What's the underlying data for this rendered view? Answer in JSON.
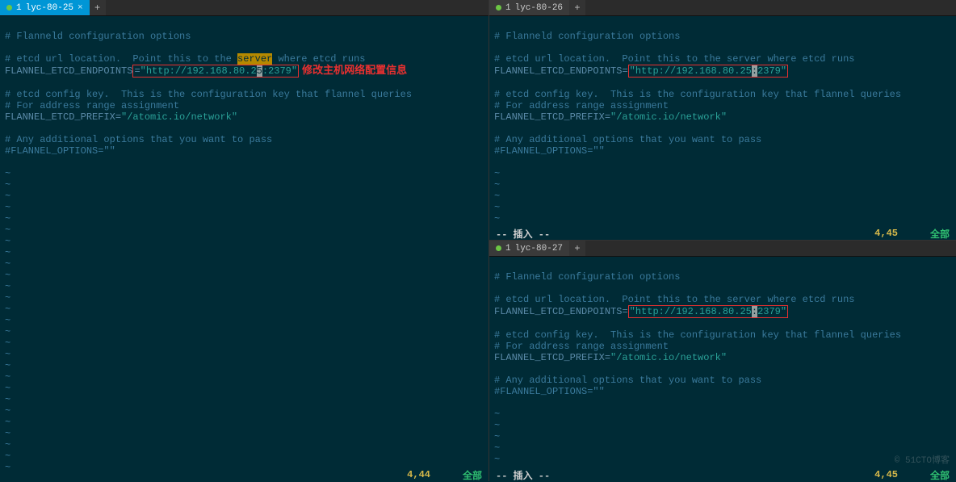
{
  "left": {
    "tab": {
      "num": "1",
      "title": "lyc-80-25",
      "close": "×"
    },
    "add": "+",
    "lines": {
      "c1": "# Flanneld configuration options",
      "c2a": "# etcd url location.  Point this to the ",
      "c2_hl": "server",
      "c2b": " where etcd runs",
      "key1": "FLANNEL_ETCD_ENDPOINTS",
      "eq": "=",
      "val1a": "\"http://192.168.80.2",
      "cursor": "5",
      "val1b": ":2379\"",
      "annot": "修改主机网络配置信息",
      "c3": "# etcd config key.  This is the configuration key that flannel queries",
      "c4": "# For address range assignment",
      "key2": "FLANNEL_ETCD_PREFIX",
      "val2": "\"/atomic.io/network\"",
      "c5": "# Any additional options that you want to pass",
      "c6": "#FLANNEL_OPTIONS=\"\"",
      "tilde": "~"
    },
    "status": {
      "pos": "4,44",
      "all": "全部"
    }
  },
  "tr": {
    "tab": {
      "num": "1",
      "title": "lyc-80-26"
    },
    "add": "+",
    "lines": {
      "c1": "# Flanneld configuration options",
      "c2": "# etcd url location.  Point this to the server where etcd runs",
      "key1": "FLANNEL_ETCD_ENDPOINTS",
      "eq": "=",
      "val1a": "\"http://192.168.80.25",
      "cursor": ":",
      "val1b": "2379\"",
      "c3": "# etcd config key.  This is the configuration key that flannel queries",
      "c4": "# For address range assignment",
      "key2": "FLANNEL_ETCD_PREFIX",
      "val2": "\"/atomic.io/network\"",
      "c5": "# Any additional options that you want to pass",
      "c6": "#FLANNEL_OPTIONS=\"\"",
      "tilde": "~"
    },
    "status": {
      "mode": "-- 插入 --",
      "pos": "4,45",
      "all": "全部"
    }
  },
  "br": {
    "tab": {
      "num": "1",
      "title": "lyc-80-27"
    },
    "add": "+",
    "lines": {
      "c1": "# Flanneld configuration options",
      "c2": "# etcd url location.  Point this to the server where etcd runs",
      "key1": "FLANNEL_ETCD_ENDPOINTS",
      "eq": "=",
      "val1a": "\"http://192.168.80.25",
      "cursor": ":",
      "val1b": "2379\"",
      "c3": "# etcd config key.  This is the configuration key that flannel queries",
      "c4": "# For address range assignment",
      "key2": "FLANNEL_ETCD_PREFIX",
      "val2": "\"/atomic.io/network\"",
      "c5": "# Any additional options that you want to pass",
      "c6": "#FLANNEL_OPTIONS=\"\"",
      "tilde": "~"
    },
    "status": {
      "mode": "-- 插入 --",
      "pos": "4,45",
      "all": "全部"
    },
    "watermark": "© 51CTO博客"
  }
}
